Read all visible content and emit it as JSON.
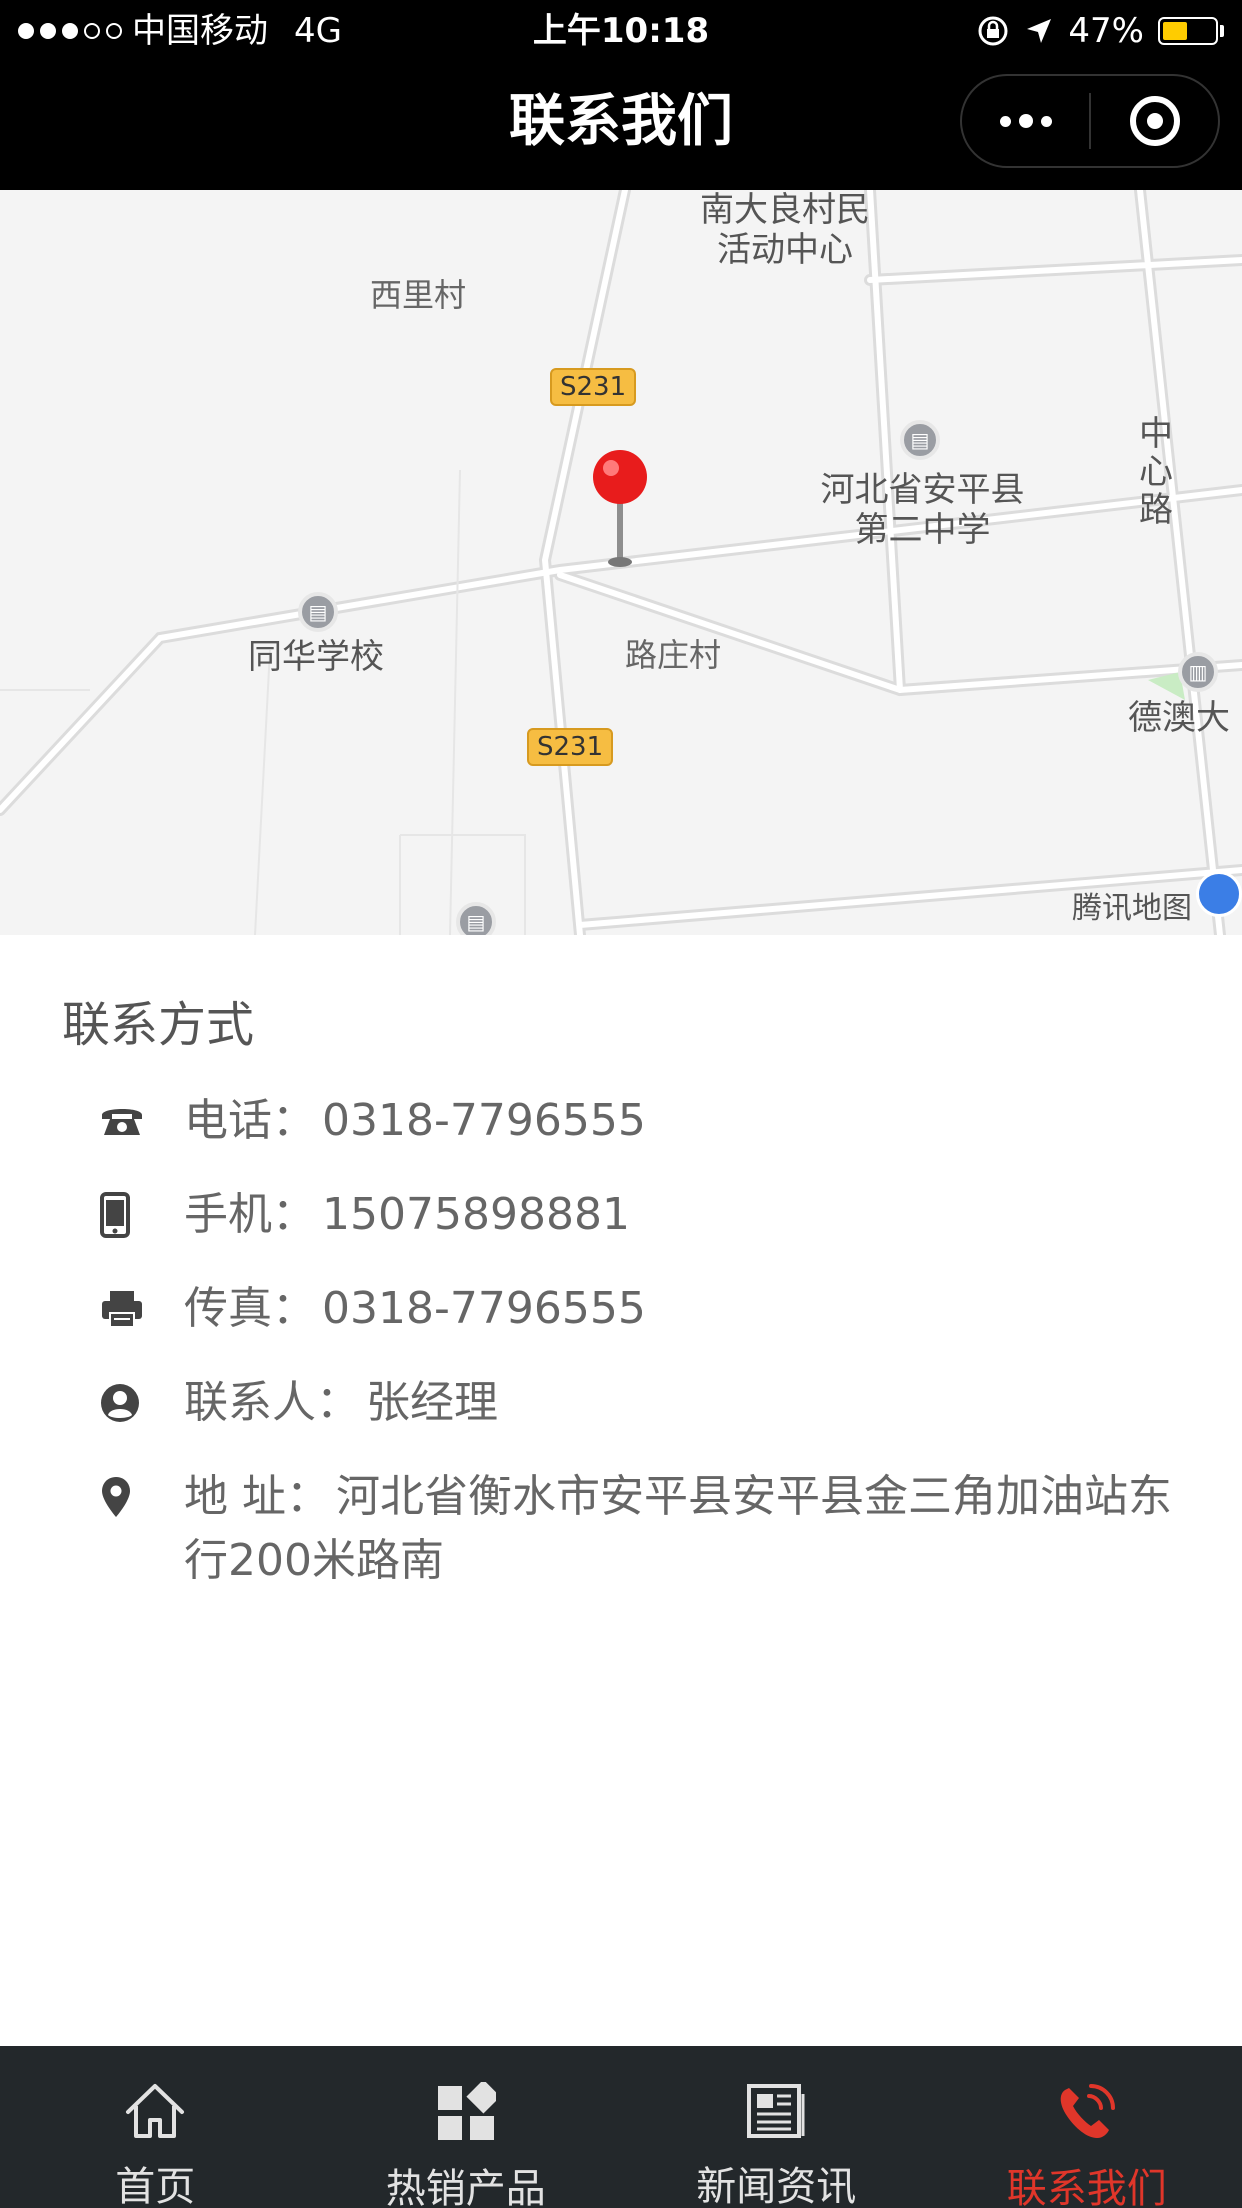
{
  "status_bar": {
    "carrier": "中国移动",
    "network": "4G",
    "time": "上午10:18",
    "battery": "47%",
    "battery_level": 0.47
  },
  "nav": {
    "title": "联系我们"
  },
  "map": {
    "labels": {
      "north": "南大良村民活动中心",
      "xili": "西里村",
      "s231_top": "S231",
      "s231_bottom": "S231",
      "school2": "河北省安平县第二中学",
      "zhongxin": "中心路",
      "tonghua": "同华学校",
      "luzhuang": "路庄村",
      "deao": "德澳大"
    },
    "watermark": "腾讯地图"
  },
  "contact": {
    "section_title": "联系方式",
    "items": [
      {
        "icon": "phone-icon",
        "label": "电话：",
        "value": "0318-7796555"
      },
      {
        "icon": "mobile-icon",
        "label": "手机：",
        "value": "15075898881"
      },
      {
        "icon": "fax-icon",
        "label": "传真：",
        "value": "0318-7796555"
      },
      {
        "icon": "user-circle-icon",
        "label": "联系人：",
        "value": "张经理"
      },
      {
        "icon": "location-pin-icon",
        "label": "地  址：",
        "value": "河北省衡水市安平县安平县金三角加油站东行200米路南"
      }
    ]
  },
  "tabs": [
    {
      "label": "首页",
      "icon": "home-icon",
      "active": false
    },
    {
      "label": "热销产品",
      "icon": "grid-products-icon",
      "active": false
    },
    {
      "label": "新闻资讯",
      "icon": "news-icon",
      "active": false
    },
    {
      "label": "联系我们",
      "icon": "phone-ring-icon",
      "active": true
    }
  ],
  "colors": {
    "active_tab": "#e0362a",
    "tab_bar_bg": "#23282b",
    "nav_bg": "#000000",
    "map_pin": "#e81c1c",
    "road_shield": "#f6bd42"
  }
}
